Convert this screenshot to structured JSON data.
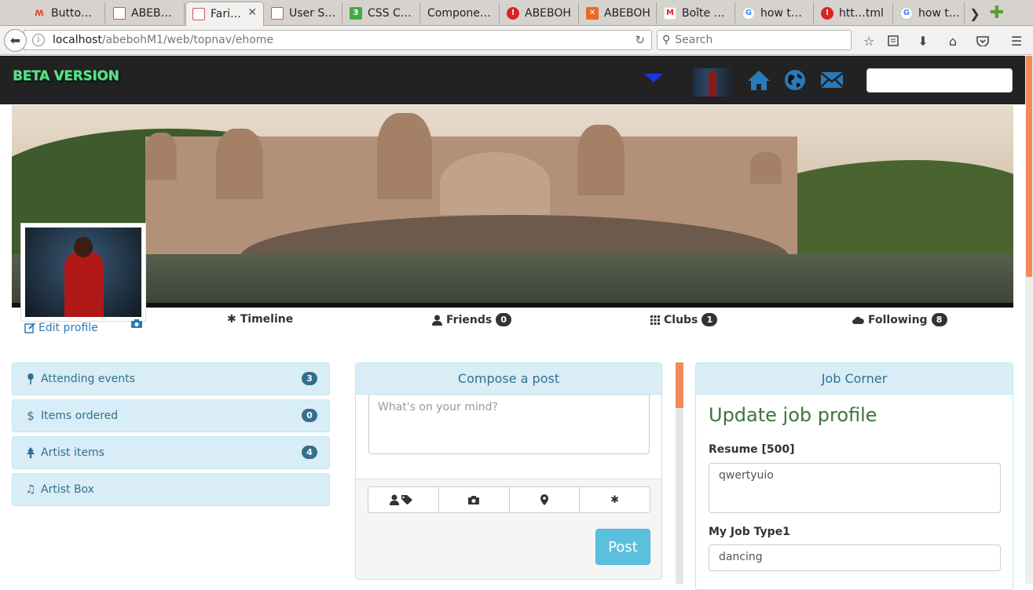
{
  "browser": {
    "tabs": [
      {
        "label": "Butto…",
        "icon": "m-icon"
      },
      {
        "label": "ABEB…",
        "icon": "page-icon"
      },
      {
        "label": "Fari…",
        "icon": "page-icon",
        "active": true
      },
      {
        "label": "User S…",
        "icon": "page-icon"
      },
      {
        "label": "CSS C…",
        "icon": "css-icon"
      },
      {
        "label": "Compone…",
        "icon": "none"
      },
      {
        "label": "ABEBOH",
        "icon": "warning-icon"
      },
      {
        "label": "ABEBOH",
        "icon": "xampp-icon"
      },
      {
        "label": "Boîte …",
        "icon": "gmail-icon"
      },
      {
        "label": "how t…",
        "icon": "google-icon"
      },
      {
        "label": "htt…tml",
        "icon": "warning-icon"
      },
      {
        "label": "how t…",
        "icon": "google-icon"
      }
    ],
    "url_host": "localhost",
    "url_path": "/abebohM1/web/topnav/ehome",
    "search_placeholder": "Search"
  },
  "nav": {
    "brand": "BETA VERSION",
    "brand_color": "#5be08a",
    "caret_color": "#1a35e8",
    "icon_color": "#2a7ab8"
  },
  "profile": {
    "edit_label": "Edit profile",
    "tabs": [
      {
        "label": "Timeline",
        "icon": "asterisk-icon"
      },
      {
        "label": "Friends",
        "icon": "user-icon",
        "count": "0"
      },
      {
        "label": "Clubs",
        "icon": "grid-icon",
        "count": "1"
      },
      {
        "label": "Following",
        "icon": "cloud-icon",
        "count": "8"
      }
    ]
  },
  "sidebar": {
    "items": [
      {
        "label": "Attending events",
        "icon": "pushpin-icon",
        "count": "3"
      },
      {
        "label": "Items ordered",
        "icon": "dollar-icon",
        "count": "0"
      },
      {
        "label": "Artist items",
        "icon": "tree-icon",
        "count": "4"
      },
      {
        "label": "Artist Box",
        "icon": "music-icon"
      }
    ]
  },
  "compose": {
    "title": "Compose a post",
    "placeholder": "What's on your mind?",
    "post_label": "Post"
  },
  "job": {
    "panel_title": "Job Corner",
    "heading": "Update job profile",
    "resume_label": "Resume [500]",
    "resume_value": "qwertyuio",
    "type_label": "My Job Type1",
    "type_value": "dancing"
  }
}
